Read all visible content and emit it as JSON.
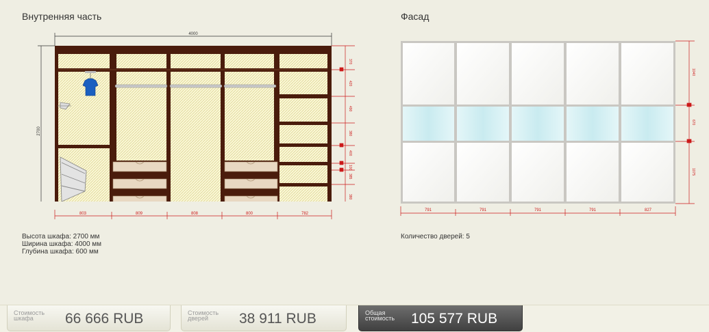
{
  "interior": {
    "title": "Внутренняя часть",
    "total_width": "4000",
    "total_height": "2700",
    "bottom_dims": [
      "803",
      "809",
      "808",
      "800",
      "782"
    ],
    "right_dims": [
      "370",
      "420",
      "490",
      "380",
      "400",
      "100",
      "385",
      "380"
    ]
  },
  "facade": {
    "title": "Фасад",
    "bottom_dims": [
      "791",
      "791",
      "791",
      "791",
      "827"
    ],
    "right_dims": [
      "1040",
      "670",
      "1075"
    ]
  },
  "specs": {
    "height": "Высота шкафа: 2700 мм",
    "width": "Ширина шкафа: 4000 мм",
    "depth": "Глубина шкафа: 600 мм"
  },
  "door_count": "Количество дверей: 5",
  "costs": {
    "cabinet": {
      "label": "Стоимость шкафа",
      "value": "66 666  RUB"
    },
    "doors": {
      "label": "Стоимость дверей",
      "value": "38 911  RUB"
    },
    "total": {
      "label": "Общая стоимость",
      "value": "105 577  RUB"
    }
  },
  "colors": {
    "frame": "#4a1c0c",
    "dims": "#cc1a1a",
    "glass": "#d9f0f2",
    "panel": "#f9f9f6"
  }
}
